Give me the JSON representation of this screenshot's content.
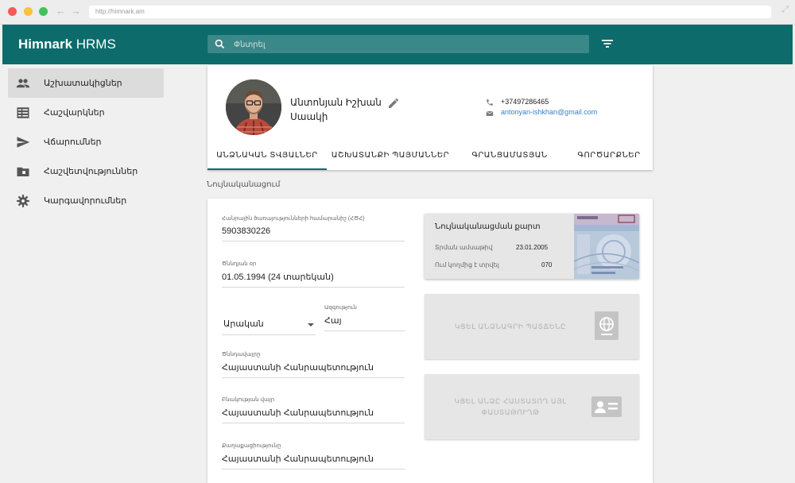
{
  "browser": {
    "url": "http://himnark.am"
  },
  "app": {
    "brand_bold": "Himnark",
    "brand_rest": " HRMS"
  },
  "search": {
    "placeholder": "Փնտրել"
  },
  "sidebar": {
    "items": [
      {
        "label": "Աշխատակիցներ",
        "icon": "people-icon",
        "active": true
      },
      {
        "label": "Հաշվարկներ",
        "icon": "list-icon",
        "active": false
      },
      {
        "label": "Վճարումներ",
        "icon": "send-icon",
        "active": false
      },
      {
        "label": "Հաշվետվություններ",
        "icon": "folder-icon",
        "active": false
      },
      {
        "label": "Կարգավորումներ",
        "icon": "gear-icon",
        "active": false
      }
    ]
  },
  "profile": {
    "name_line1": "Անտոնյան Իշխան",
    "name_line2": "Սաակի",
    "phone": "+37497286465",
    "email": "antonyan-ishkhan@gmail.com"
  },
  "tabs": [
    {
      "label": "ԱՆՁՆԱԿԱՆ ՏՎՅԱԼՆԵՐ",
      "active": true
    },
    {
      "label": "ԱՇԽԱՏԱՆՔԻ ՊԱՅՄԱՆՆԵՐ",
      "active": false
    },
    {
      "label": "ԳՐԱՆՑԱՄԱՏՅԱՆ",
      "active": false
    },
    {
      "label": "ԳՈՐԾԱՐՔՆԵՐ",
      "active": false
    }
  ],
  "section": {
    "title": "Նույնականացում"
  },
  "fields": {
    "ssn": {
      "label": "Հանրային ծառայությունների համարանիշ (ՀԾՀ)",
      "value": "5903830226"
    },
    "birthdate": {
      "label": "Ծննդյան օր",
      "value": "01.05.1994 (24 տարեկան)"
    },
    "gender": {
      "value": "Արական"
    },
    "nationality": {
      "label": "Ազգություն",
      "value": "Հայ"
    },
    "birthplace": {
      "label": "Ծննդավայրը",
      "value": "Հայաստանի Հանրապետություն"
    },
    "residence": {
      "label": "Բնակության վայր",
      "value": "Հայաստանի Հանրապետություն"
    },
    "citizenship": {
      "label": "Քաղաքացիությունը",
      "value": "Հայաստանի Հանրապետություն"
    }
  },
  "id_card": {
    "title": "Նույնականացման քարտ",
    "issue_label": "Տրման ամսաթիվ",
    "issue_value": "23.01.2005",
    "issuer_label": "Ում կողմից է տրվել",
    "issuer_value": "070"
  },
  "attachments": {
    "passport": "ԿՑԵԼ ԱՆՁՆԱԳՐԻ ՊԱՏՃԵՆԸ",
    "other_doc": "ԿՑԵԼ ԱՆՁԸ ՀԱՍՏԱՏՈՂ ԱՅԼ ՓԱՍՏԱԹՈՒՂԹ"
  },
  "colors": {
    "primary": "#0d6b6b",
    "link": "#3b7fc4"
  }
}
